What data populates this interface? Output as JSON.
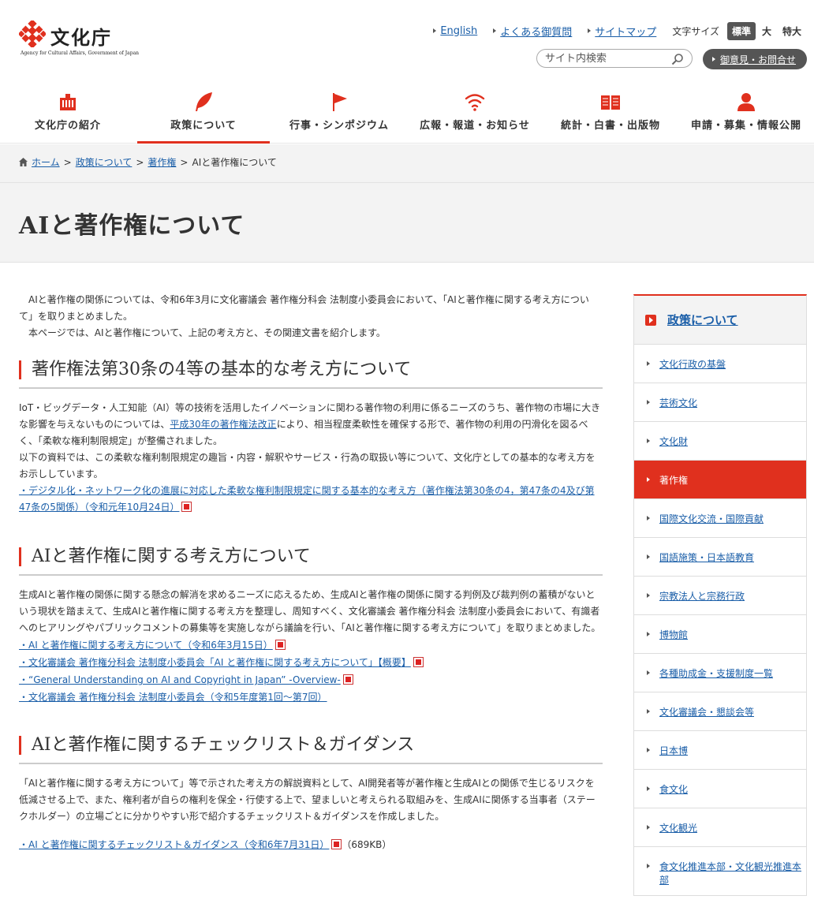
{
  "header": {
    "logo_text": "文化庁",
    "logo_sub": "Agency for Cultural Affairs, Government of Japan",
    "links": [
      "English",
      "よくある御質問",
      "サイトマップ"
    ],
    "font_size_label": "文字サイズ",
    "font_sizes": [
      "標準",
      "大",
      "特大"
    ],
    "search_placeholder": "サイト内検索",
    "contact": "御意見・お問合せ"
  },
  "nav": [
    {
      "label": "文化庁の紹介",
      "icon": "building-icon"
    },
    {
      "label": "政策について",
      "icon": "feather-icon"
    },
    {
      "label": "行事・シンポジウム",
      "icon": "flag-icon"
    },
    {
      "label": "広報・報道・お知らせ",
      "icon": "wifi-icon"
    },
    {
      "label": "統計・白書・出版物",
      "icon": "book-icon"
    },
    {
      "label": "申請・募集・情報公開",
      "icon": "person-icon"
    }
  ],
  "breadcrumb": {
    "home": "ホーム",
    "policy": "政策について",
    "copyright": "著作権",
    "current": "AIと著作権について"
  },
  "page_title": "AIと著作権について",
  "intro": {
    "p1": "　AIと著作権の関係については、令和6年3月に文化審議会 著作権分科会 法制度小委員会において、「AIと著作権に関する考え方について」を取りまとめました。",
    "p2": "　本ページでは、AIと著作権について、上記の考え方と、その関連文書を紹介します。"
  },
  "section1": {
    "title": "著作権法第30条の4等の基本的な考え方について",
    "text_a": "IoT・ビッグデータ・人工知能（AI）等の技術を活用したイノベーションに関わる著作物の利用に係るニーズのうち、著作物の市場に大きな影響を与えないものについては、",
    "link_inline": "平成30年の著作権法改正",
    "text_b": "により、相当程度柔軟性を確保する形で、著作物の利用の円滑化を図るべく、「柔軟な権利制限規定」が整備されました。",
    "text_c": "以下の資料では、この柔軟な権利制限規定の趣旨・内容・解釈やサービス・行為の取扱い等について、文化庁としての基本的な考え方をお示ししています。",
    "link": "・デジタル化・ネットワーク化の進展に対応した柔軟な権利制限規定に関する基本的な考え方（著作権法第30条の4，第47条の4及び第47条の5関係）（令和元年10月24日）"
  },
  "section2": {
    "title": "AIと著作権に関する考え方について",
    "text": "生成AIと著作権の関係に関する懸念の解消を求めるニーズに応えるため、生成AIと著作権の関係に関する判例及び裁判例の蓄積がないという現状を踏まえて、生成AIと著作権に関する考え方を整理し、周知すべく、文化審議会 著作権分科会 法制度小委員会において、有識者へのヒアリングやパブリックコメントの募集等を実施しながら議論を行い、「AIと著作権に関する考え方について」を取りまとめました。",
    "links": [
      "・AI と著作権に関する考え方について（令和6年3月15日）",
      "・文化審議会 著作権分科会 法制度小委員会「AI と著作権に関する考え方について」【概要】",
      "・“General Understanding on AI and Copyright in Japan” -Overview-",
      "・文化審議会 著作権分科会 法制度小委員会（令和5年度第1回～第7回）"
    ]
  },
  "section3": {
    "title": "AIと著作権に関するチェックリスト＆ガイダンス",
    "text": "「AIと著作権に関する考え方について」等で示された考え方の解説資料として、AI開発者等が著作権と生成AIとの関係で生じるリスクを低減させる上で、また、権利者が自らの権利を保全・行使する上で、望ましいと考えられる取組みを、生成AIに関係する当事者（ステークホルダー）の立場ごとに分かりやすい形で紹介するチェックリスト＆ガイダンスを作成しました。",
    "link": "・AI と著作権に関するチェックリスト＆ガイダンス（令和6年7月31日）",
    "size": "（689KB）"
  },
  "sidebar": {
    "heading": "政策について",
    "items": [
      "文化行政の基盤",
      "芸術文化",
      "文化財",
      "著作権",
      "国際文化交流・国際貢献",
      "国語施策・日本語教育",
      "宗教法人と宗務行政",
      "博物館",
      "各種助成金・支援制度一覧",
      "文化審議会・懇談会等",
      "日本博",
      "食文化",
      "文化観光",
      "食文化推進本部・文化観光推進本部"
    ]
  },
  "colors": {
    "accent": "#e0301e",
    "link": "#1a5ea8"
  }
}
